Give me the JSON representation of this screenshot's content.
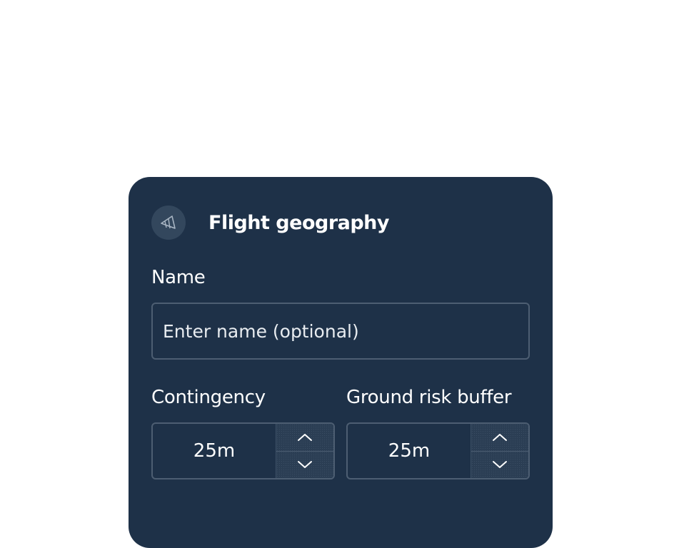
{
  "panel": {
    "title": "Flight geography",
    "icon": "flight-geography-icon",
    "background_color": "#1e3148"
  },
  "name_field": {
    "label": "Name",
    "placeholder": "Enter name (optional)",
    "value": ""
  },
  "contingency": {
    "label": "Contingency",
    "value": "25m"
  },
  "ground_risk_buffer": {
    "label": "Ground risk buffer",
    "value": "25m"
  }
}
